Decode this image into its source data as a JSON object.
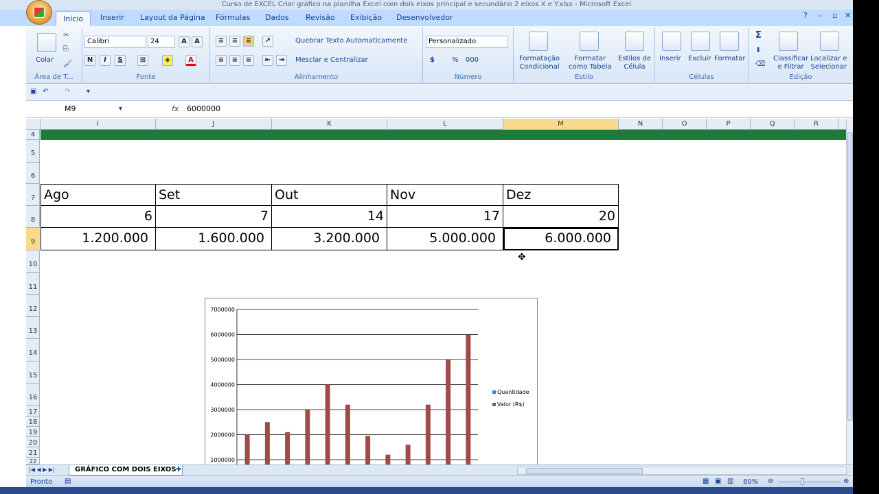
{
  "window": {
    "title": "Curso de EXCEL Criar gráfico na planilha Excel com dois eixos principal e secundário 2 eixos X e Y.xlsx - Microsoft Excel"
  },
  "tabs": [
    "Início",
    "Inserir",
    "Layout da Página",
    "Fórmulas",
    "Dados",
    "Revisão",
    "Exibição",
    "Desenvolvedor"
  ],
  "ribbon": {
    "clipboard": {
      "paste": "Colar",
      "label": "Área de T..."
    },
    "font": {
      "name": "Calibri",
      "size": "24",
      "bold": "N",
      "italic": "I",
      "underline": "S",
      "label": "Fonte"
    },
    "alignment": {
      "wrap": "Quebrar Texto Automaticamente",
      "merge": "Mesclar e Centralizar",
      "label": "Alinhamento"
    },
    "number": {
      "format": "Personalizado",
      "currency": "$",
      "percent": "%",
      "thousands": "000",
      "label": "Número"
    },
    "styles": {
      "cond1": "Formatação",
      "cond2": "Condicional",
      "table1": "Formatar",
      "table2": "como Tabela",
      "cell1": "Estilos de",
      "cell2": "Célula",
      "label": "Estilo"
    },
    "cells": {
      "insert": "Inserir",
      "delete": "Excluir",
      "format": "Formatar",
      "label": "Células"
    },
    "editing": {
      "sort1": "Classificar",
      "sort2": "e Filtrar",
      "find1": "Localizar e",
      "find2": "Selecionar",
      "label": "Edição"
    }
  },
  "formula_bar": {
    "name_box": "M9",
    "fx": "fx",
    "value": "6000000"
  },
  "columns": [
    "I",
    "J",
    "K",
    "L",
    "M",
    "N",
    "O",
    "P",
    "Q",
    "R"
  ],
  "rows": [
    "4",
    "5",
    "6",
    "7",
    "8",
    "9",
    "10",
    "11",
    "12",
    "13",
    "14",
    "15",
    "16",
    "17",
    "18",
    "19",
    "20",
    "21",
    "22"
  ],
  "table": {
    "months": [
      "Ago",
      "Set",
      "Out",
      "Nov",
      "Dez"
    ],
    "quantities": [
      "6",
      "7",
      "14",
      "17",
      "20"
    ],
    "values": [
      "1.200.000",
      "1.600.000",
      "3.200.000",
      "5.000.000",
      "6.000.000"
    ]
  },
  "chart_data": {
    "type": "bar",
    "series": [
      {
        "name": "Quantidade",
        "values": [
          0,
          0,
          0,
          0,
          0,
          0,
          0,
          0,
          0,
          0,
          0,
          0
        ]
      },
      {
        "name": "Valor (R$)",
        "values": [
          2000000,
          2500000,
          2100000,
          3000000,
          4000000,
          3200000,
          1950000,
          1200000,
          1600000,
          3200000,
          5000000,
          6000000
        ]
      }
    ],
    "yticks": [
      "7000000",
      "6000000",
      "5000000",
      "4000000",
      "3000000",
      "2000000",
      "1000000"
    ],
    "ylim": [
      0,
      7000000
    ],
    "colors": [
      "#4f81bd",
      "#a04a4a"
    ],
    "legend_position": "right"
  },
  "sheet_tab": "GRÁFICO COM DOIS EIXOS",
  "status": {
    "ready": "Pronto",
    "zoom": "80%"
  }
}
